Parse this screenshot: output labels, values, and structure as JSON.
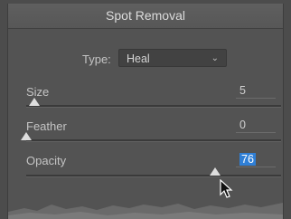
{
  "panel": {
    "title": "Spot Removal",
    "type": {
      "label": "Type:",
      "selected": "Heal",
      "chevron_icon": "chevron-down-icon"
    },
    "sliders": [
      {
        "label": "Size",
        "value": "5"
      },
      {
        "label": "Feather",
        "value": "0"
      },
      {
        "label": "Opacity",
        "value": "76"
      }
    ]
  },
  "colors": {
    "panel_bg": "#535353",
    "selection": "#2f7fd6",
    "thumb": "#dedede"
  }
}
